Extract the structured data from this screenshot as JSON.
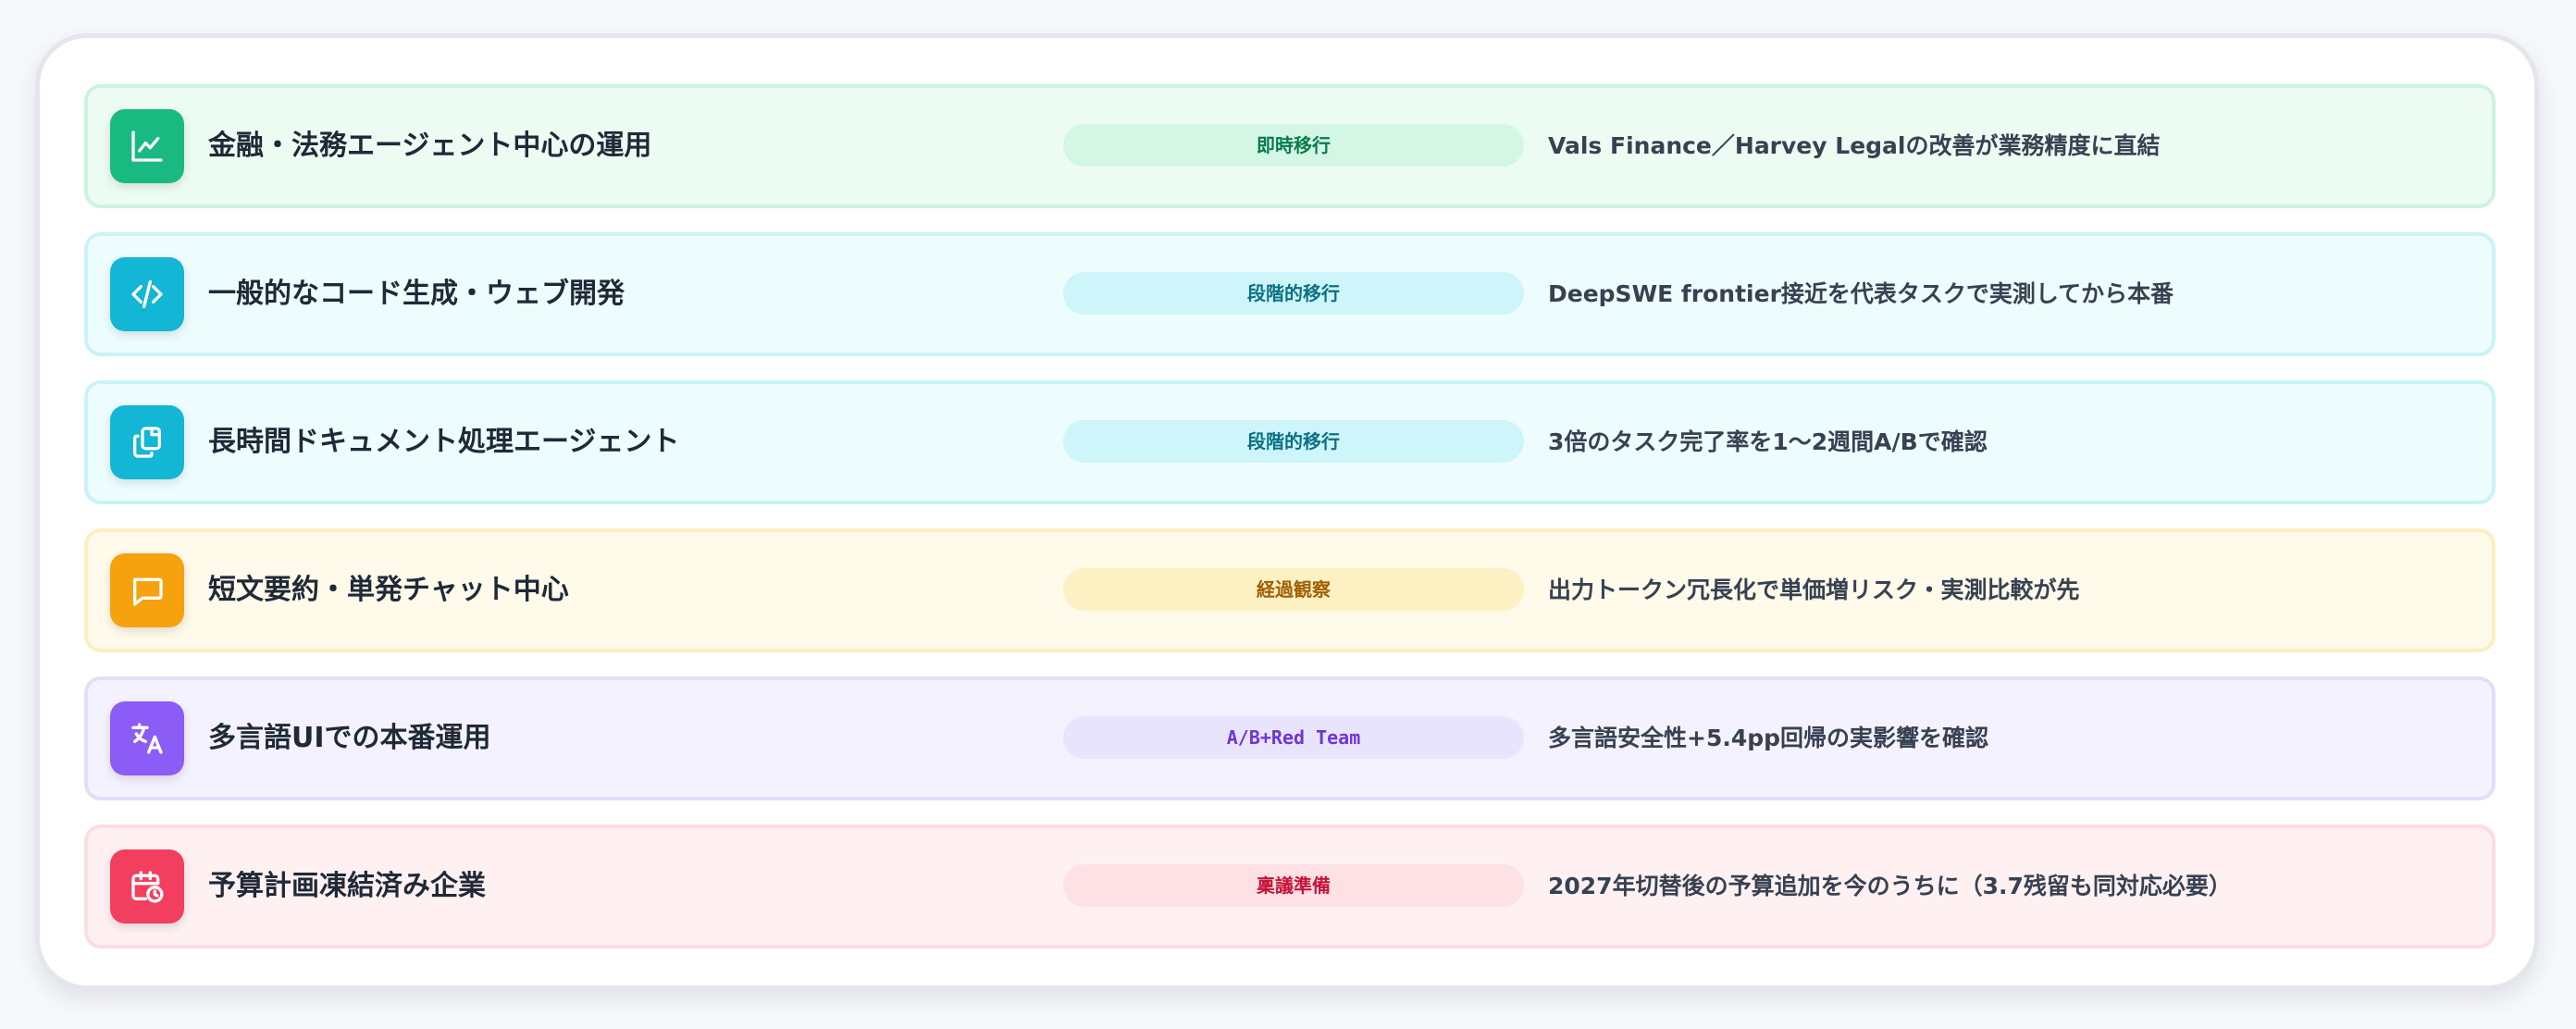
{
  "rows": [
    {
      "title": "金融・法務エージェント中心の運用",
      "badge": "即時移行",
      "note": "Vals Finance／Harvey Legalの改善が業務精度に直結",
      "icon": "line-chart-icon",
      "color": "#19b982"
    },
    {
      "title": "一般的なコード生成・ウェブ開発",
      "badge": "段階的移行",
      "note": "DeepSWE frontier接近を代表タスクで実測してから本番",
      "icon": "code-icon",
      "color": "#13b6d4"
    },
    {
      "title": "長時間ドキュメント処理エージェント",
      "badge": "段階的移行",
      "note": "3倍のタスク完了率を1〜2週間A/Bで確認",
      "icon": "documents-icon",
      "color": "#13b6d4"
    },
    {
      "title": "短文要約・単発チャット中心",
      "badge": "経過観察",
      "note": "出力トークン冗長化で単価増リスク・実測比較が先",
      "icon": "chat-icon",
      "color": "#f6a10e"
    },
    {
      "title": "多言語UIでの本番運用",
      "badge": "A/B+Red Team",
      "note": "多言語安全性+5.4pp回帰の実影響を確認",
      "icon": "translate-icon",
      "color": "#8b5cf6"
    },
    {
      "title": "予算計画凍結済み企業",
      "badge": "稟議準備",
      "note": "2027年切替後の予算追加を今のうちに（3.7残留も同対応必要）",
      "icon": "calendar-clock-icon",
      "color": "#f23f5f"
    }
  ]
}
